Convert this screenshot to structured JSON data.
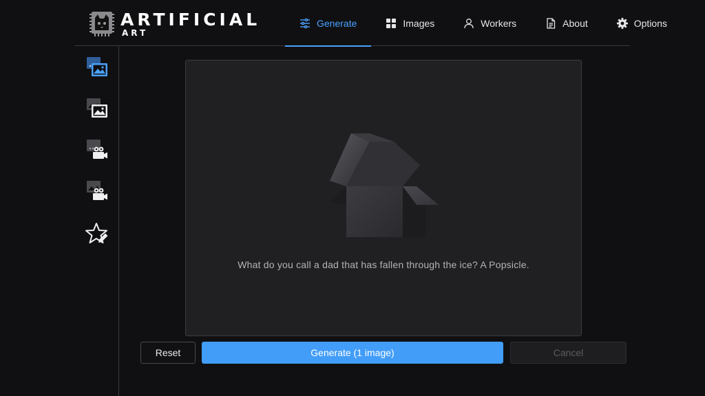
{
  "header": {
    "logo_title": "ARTIFICIAL",
    "logo_subtitle": "ART",
    "tabs": [
      {
        "label": "Generate",
        "icon": "sliders-icon",
        "active": true
      },
      {
        "label": "Images",
        "icon": "grid-icon",
        "active": false
      },
      {
        "label": "Workers",
        "icon": "user-icon",
        "active": false
      },
      {
        "label": "About",
        "icon": "document-icon",
        "active": false
      },
      {
        "label": "Options",
        "icon": "gear-icon",
        "active": false
      }
    ]
  },
  "sidebar": {
    "items": [
      {
        "icon": "text-to-image-icon",
        "active": true
      },
      {
        "icon": "image-to-image-icon",
        "active": false
      },
      {
        "icon": "text-to-video-icon",
        "active": false
      },
      {
        "icon": "image-to-video-icon",
        "active": false
      },
      {
        "icon": "star-edit-icon",
        "active": false
      }
    ]
  },
  "main": {
    "placeholder_text": "What do you call a dad that has fallen through the ice? A Popsicle."
  },
  "actions": {
    "reset_label": "Reset",
    "generate_label": "Generate (1 image)",
    "cancel_label": "Cancel"
  },
  "colors": {
    "accent": "#4aa1ff",
    "background": "#101012",
    "panel": "#202023"
  }
}
